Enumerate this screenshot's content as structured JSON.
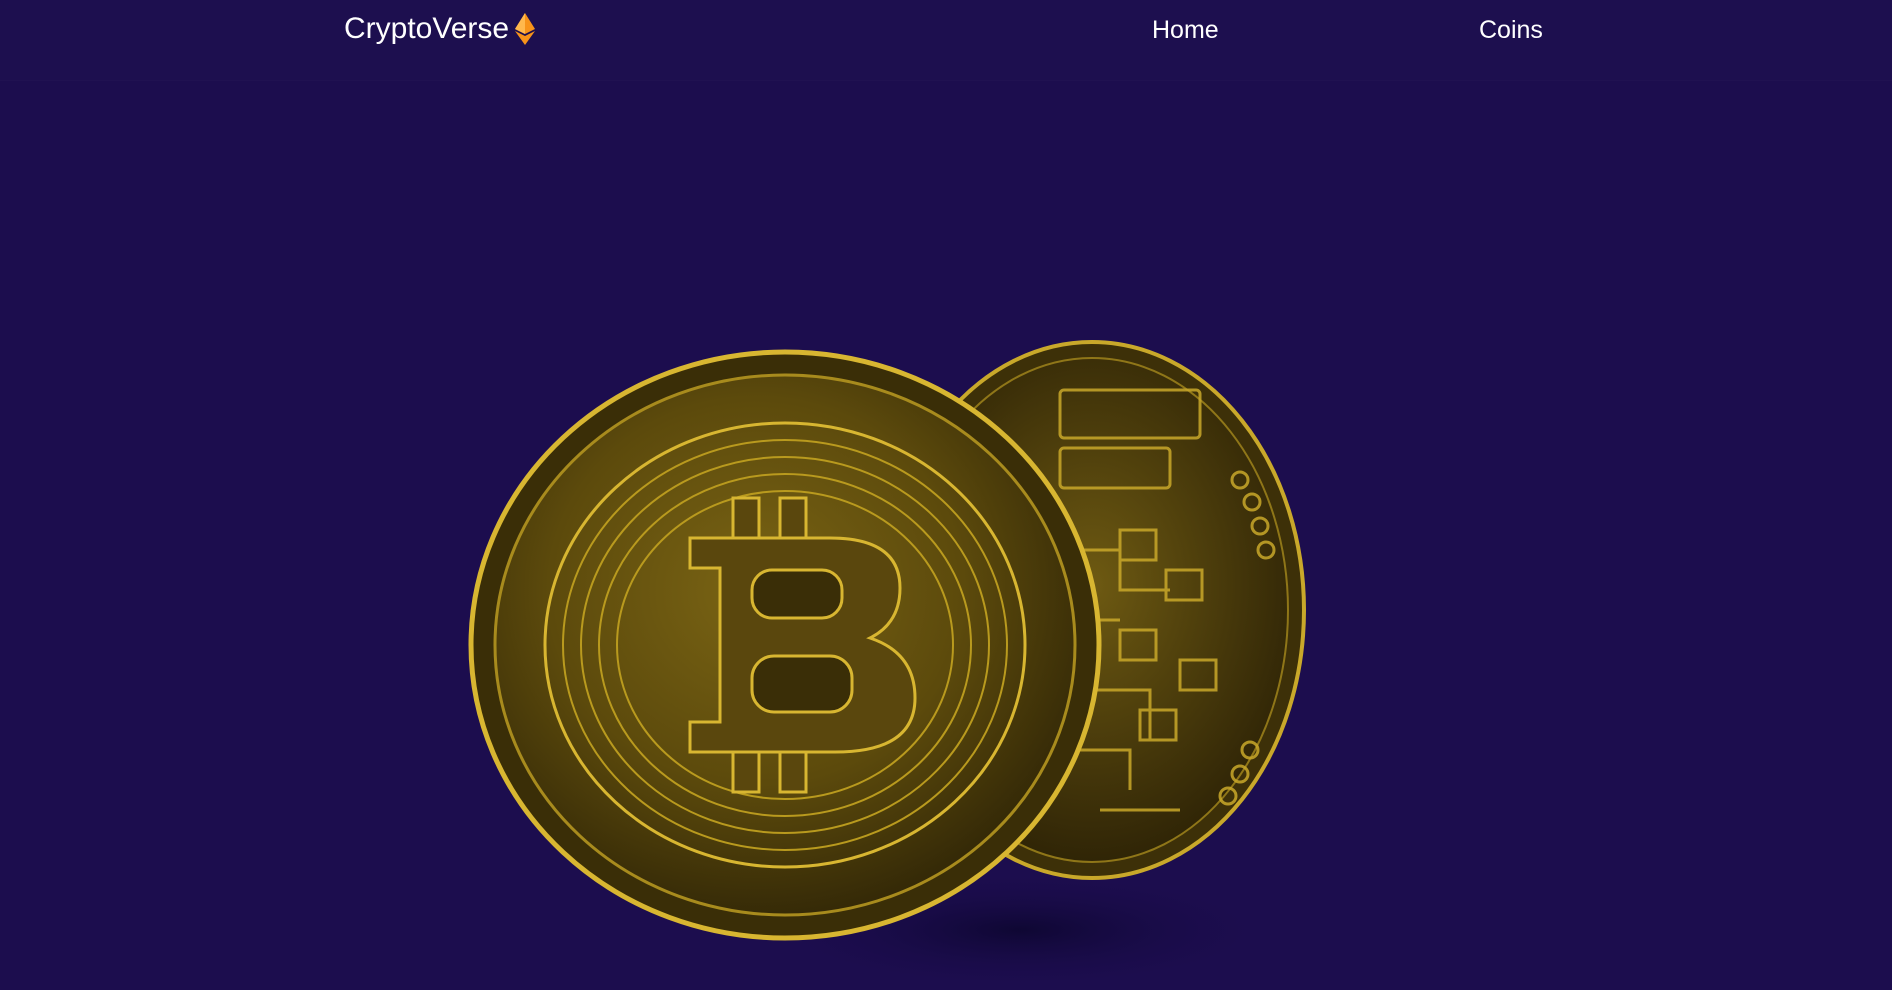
{
  "navbar": {
    "brand_name": "CryptoVerse",
    "brand_icon": "ethereum-icon",
    "links": [
      {
        "label": "Home"
      },
      {
        "label": "Coins"
      }
    ]
  },
  "hero": {
    "image": "bitcoin-coins-image"
  },
  "colors": {
    "background": "#1c0d4e",
    "navbar": "#1d0f4f",
    "accent": "#f7931a",
    "coin_gold": "#b99a1e"
  }
}
